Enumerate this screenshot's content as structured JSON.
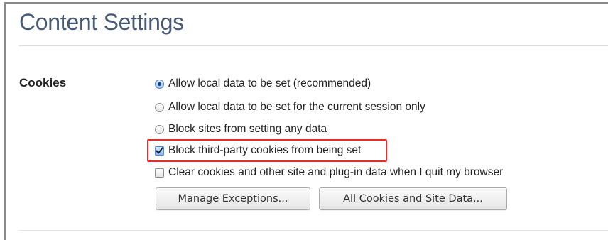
{
  "page": {
    "title": "Content Settings"
  },
  "cookies": {
    "label": "Cookies",
    "radio_options": [
      {
        "label": "Allow local data to be set (recommended)",
        "selected": true
      },
      {
        "label": "Allow local data to be set for the current session only",
        "selected": false
      },
      {
        "label": "Block sites from setting any data",
        "selected": false
      }
    ],
    "checkbox_options": [
      {
        "label": "Block third-party cookies from being set",
        "checked": true,
        "highlighted": true
      },
      {
        "label": "Clear cookies and other site and plug-in data when I quit my browser",
        "checked": false,
        "highlighted": false
      }
    ],
    "buttons": {
      "manage_exceptions": "Manage Exceptions...",
      "all_cookies": "All Cookies and Site Data..."
    }
  },
  "colors": {
    "title": "#4a5a75",
    "highlight_box": "#e52b2b"
  }
}
